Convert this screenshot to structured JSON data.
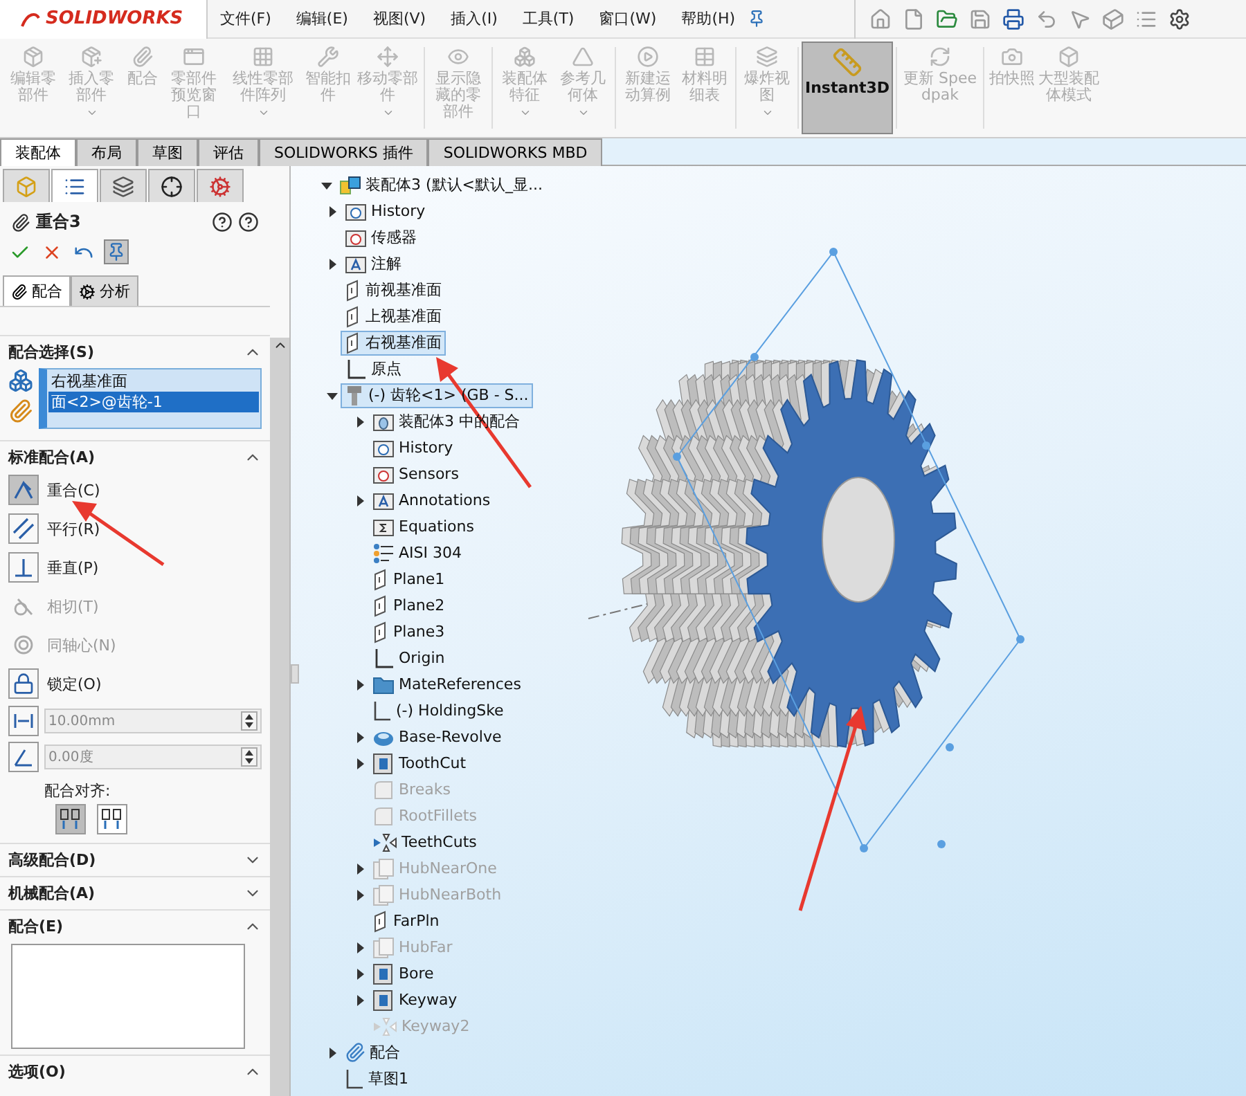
{
  "logo": "SOLIDWORKS",
  "menu": [
    "文件(F)",
    "编辑(E)",
    "视图(V)",
    "插入(I)",
    "工具(T)",
    "窗口(W)",
    "帮助(H)"
  ],
  "ribbon": [
    {
      "label": "编辑零部件",
      "disabled": true,
      "dropdown": false,
      "selected": false
    },
    {
      "label": "插入零部件",
      "disabled": true,
      "dropdown": true,
      "selected": false
    },
    {
      "label": "配合",
      "disabled": true,
      "dropdown": false,
      "selected": false
    },
    {
      "label": "零部件预览窗口",
      "disabled": true,
      "dropdown": false,
      "selected": false
    },
    {
      "label": "线性零部件阵列",
      "disabled": true,
      "dropdown": true,
      "selected": false
    },
    {
      "label": "智能扣件",
      "disabled": true,
      "dropdown": false,
      "selected": false
    },
    {
      "label": "移动零部件",
      "disabled": true,
      "dropdown": true,
      "selected": false
    },
    {
      "label": "显示隐藏的零部件",
      "disabled": true,
      "dropdown": false,
      "selected": false
    },
    {
      "label": "装配体特征",
      "disabled": true,
      "dropdown": true,
      "selected": false
    },
    {
      "label": "参考几何体",
      "disabled": true,
      "dropdown": true,
      "selected": false
    },
    {
      "label": "新建运动算例",
      "disabled": true,
      "dropdown": false,
      "selected": false
    },
    {
      "label": "材料明细表",
      "disabled": true,
      "dropdown": false,
      "selected": false
    },
    {
      "label": "爆炸视图",
      "disabled": true,
      "dropdown": true,
      "selected": false
    },
    {
      "label": "Instant3D",
      "disabled": false,
      "dropdown": false,
      "selected": true
    },
    {
      "label": "更新 Speedpak",
      "disabled": true,
      "dropdown": false,
      "selected": false
    },
    {
      "label": "拍快照",
      "disabled": true,
      "dropdown": false,
      "selected": false
    },
    {
      "label": "大型装配体模式",
      "disabled": true,
      "dropdown": false,
      "selected": false
    }
  ],
  "command_tabs": [
    {
      "label": "装配体",
      "selected": true
    },
    {
      "label": "布局",
      "selected": false
    },
    {
      "label": "草图",
      "selected": false
    },
    {
      "label": "评估",
      "selected": false
    },
    {
      "label": "SOLIDWORKS 插件",
      "selected": false
    },
    {
      "label": "SOLIDWORKS MBD",
      "selected": false
    }
  ],
  "property_manager": {
    "tabs": [
      {
        "selected": false
      },
      {
        "selected": true
      },
      {
        "selected": false
      },
      {
        "selected": false
      },
      {
        "selected": false
      }
    ],
    "title": "重合3",
    "subtabs": [
      {
        "label": "配合",
        "selected": true
      },
      {
        "label": "分析",
        "selected": false
      }
    ],
    "selections": {
      "title": "配合选择(S)",
      "expanded": true,
      "items": [
        {
          "label": "右视基准面",
          "selected": false
        },
        {
          "label": "面<2>@齿轮-1",
          "selected": true
        }
      ]
    },
    "standard": {
      "title": "标准配合(A)",
      "expanded": true,
      "mates": [
        {
          "label": "重合(C)",
          "selected": true,
          "disabled": false
        },
        {
          "label": "平行(R)",
          "selected": false,
          "disabled": false
        },
        {
          "label": "垂直(P)",
          "selected": false,
          "disabled": false
        },
        {
          "label": "相切(T)",
          "selected": false,
          "disabled": true
        },
        {
          "label": "同轴心(N)",
          "selected": false,
          "disabled": true
        },
        {
          "label": "锁定(O)",
          "selected": false,
          "disabled": false
        }
      ],
      "distance": {
        "value": "10.00mm",
        "disabled": true
      },
      "angle": {
        "value": "0.00度",
        "disabled": true
      },
      "alignment": {
        "label": "配合对齐:",
        "options": [
          {
            "selected": true
          },
          {
            "selected": false
          }
        ]
      }
    },
    "more_sections": [
      {
        "title": "高级配合(D)",
        "expanded": false
      },
      {
        "title": "机械配合(A)",
        "expanded": false
      }
    ],
    "mates_list": {
      "title": "配合(E)",
      "expanded": true
    },
    "options": {
      "title": "选项(O)",
      "expanded": true
    }
  },
  "tree": [
    {
      "label": "装配体3  (默认<默认_显...",
      "kind": "assembly",
      "expanded": true,
      "selected": false,
      "disabled": false,
      "children": [
        {
          "label": "History",
          "kind": "history",
          "expanded": false,
          "selected": false,
          "disabled": false
        },
        {
          "label": "传感器",
          "kind": "sensor",
          "selected": false,
          "disabled": false
        },
        {
          "label": "注解",
          "kind": "annotation",
          "expanded": false,
          "selected": false,
          "disabled": false
        },
        {
          "label": "前视基准面",
          "kind": "plane",
          "selected": false,
          "disabled": false
        },
        {
          "label": "上视基准面",
          "kind": "plane",
          "selected": false,
          "disabled": false
        },
        {
          "label": "右视基准面",
          "kind": "plane",
          "selected": true,
          "disabled": false
        },
        {
          "label": "原点",
          "kind": "origin",
          "selected": false,
          "disabled": false
        },
        {
          "label": "(-) 齿轮<1> (GB - S...",
          "kind": "part",
          "expanded": true,
          "selected": true,
          "disabled": false,
          "children": [
            {
              "label": "装配体3 中的配合",
              "kind": "mates",
              "expanded": false,
              "selected": false,
              "disabled": false
            },
            {
              "label": "History",
              "kind": "history",
              "selected": false,
              "disabled": false
            },
            {
              "label": "Sensors",
              "kind": "sensor",
              "selected": false,
              "disabled": false
            },
            {
              "label": "Annotations",
              "kind": "annotation",
              "expanded": false,
              "selected": false,
              "disabled": false
            },
            {
              "label": "Equations",
              "kind": "equations",
              "selected": false,
              "disabled": false
            },
            {
              "label": "AISI 304",
              "kind": "material",
              "selected": false,
              "disabled": false
            },
            {
              "label": "Plane1",
              "kind": "plane",
              "selected": false,
              "disabled": false
            },
            {
              "label": "Plane2",
              "kind": "plane",
              "selected": false,
              "disabled": false
            },
            {
              "label": "Plane3",
              "kind": "plane",
              "selected": false,
              "disabled": false
            },
            {
              "label": "Origin",
              "kind": "origin",
              "selected": false,
              "disabled": false
            },
            {
              "label": "MateReferences",
              "kind": "folder",
              "expanded": false,
              "selected": false,
              "disabled": false
            },
            {
              "label": "(-) HoldingSke",
              "kind": "sketch",
              "selected": false,
              "disabled": false
            },
            {
              "label": "Base-Revolve",
              "kind": "revolve",
              "expanded": false,
              "selected": false,
              "disabled": false
            },
            {
              "label": "ToothCut",
              "kind": "cut",
              "expanded": false,
              "selected": false,
              "disabled": false
            },
            {
              "label": "Breaks",
              "kind": "fillet",
              "selected": false,
              "disabled": true
            },
            {
              "label": "RootFillets",
              "kind": "fillet",
              "selected": false,
              "disabled": true
            },
            {
              "label": "TeethCuts",
              "kind": "pattern",
              "selected": false,
              "disabled": false
            },
            {
              "label": "HubNearOne",
              "kind": "boss",
              "expanded": false,
              "selected": false,
              "disabled": true
            },
            {
              "label": "HubNearBoth",
              "kind": "boss",
              "expanded": false,
              "selected": false,
              "disabled": true
            },
            {
              "label": "FarPln",
              "kind": "plane",
              "selected": false,
              "disabled": false
            },
            {
              "label": "HubFar",
              "kind": "boss",
              "expanded": false,
              "selected": false,
              "disabled": true
            },
            {
              "label": "Bore",
              "kind": "cut",
              "expanded": false,
              "selected": false,
              "disabled": false
            },
            {
              "label": "Keyway",
              "kind": "cut",
              "expanded": false,
              "selected": false,
              "disabled": false
            },
            {
              "label": "Keyway2",
              "kind": "pattern",
              "selected": false,
              "disabled": true
            }
          ]
        },
        {
          "label": "配合",
          "kind": "mategroup",
          "expanded": false,
          "selected": false,
          "disabled": false
        },
        {
          "label": "草图1",
          "kind": "sketch",
          "selected": false,
          "disabled": false
        }
      ]
    }
  ]
}
